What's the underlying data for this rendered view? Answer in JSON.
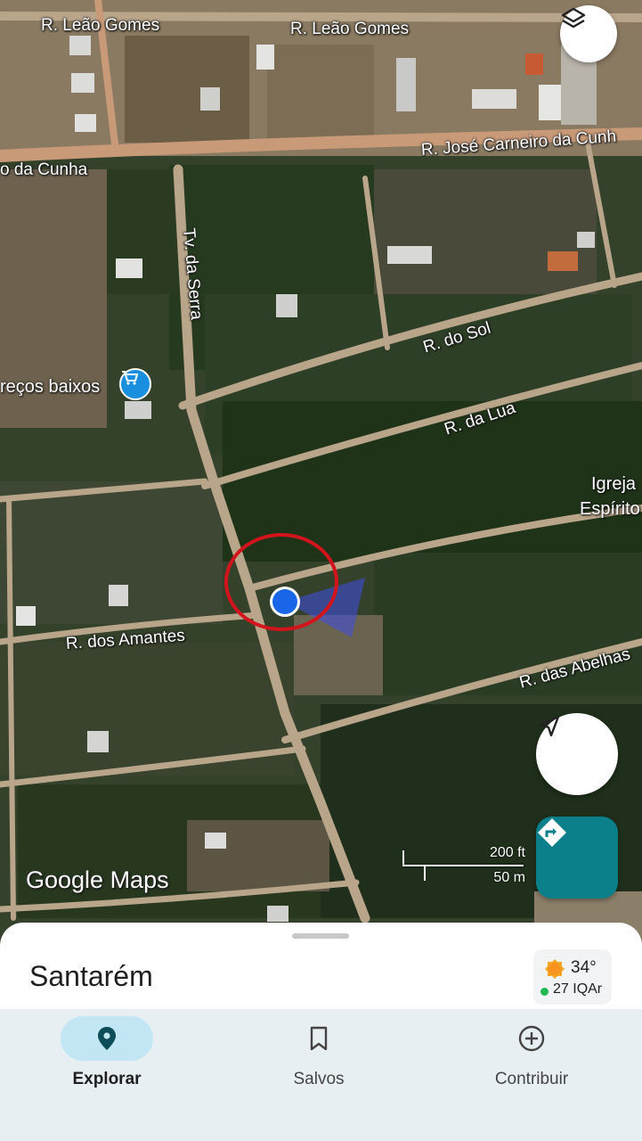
{
  "map": {
    "streets": [
      {
        "name": "R. Leão Gomes"
      },
      {
        "name": "R. Leão Gomes"
      },
      {
        "name": "R. José Carneiro da Cunh"
      },
      {
        "name": "o da Cunha"
      },
      {
        "name": "Tv. da Serra"
      },
      {
        "name": "R. do Sol"
      },
      {
        "name": "R. da Lua"
      },
      {
        "name": "R. dos Amantes"
      },
      {
        "name": "R. das Abelhas"
      }
    ],
    "pois": [
      {
        "name": "reços baixos",
        "icon": "shopping-cart-icon"
      },
      {
        "name": "Igreja",
        "icon": ""
      },
      {
        "name": "Espírito",
        "icon": ""
      }
    ],
    "attribution": "Google Maps",
    "scale": {
      "imperial": "200 ft",
      "metric": "50 m"
    },
    "accent": "#0b7f8a",
    "marker_color": "#1a66e8",
    "highlight_color": "#d4141c"
  },
  "buttons": {
    "layers_icon": "layers-icon",
    "location_icon": "navigation-arrow-icon",
    "directions_icon": "directions-icon"
  },
  "sheet": {
    "place": "Santarém",
    "weather": {
      "temperature": "34°",
      "air_quality": "27 IQAr",
      "icon": "sun-icon"
    }
  },
  "nav": {
    "items": [
      {
        "label": "Explorar",
        "icon": "explore-pin-icon",
        "active": true
      },
      {
        "label": "Salvos",
        "icon": "bookmark-icon",
        "active": false
      },
      {
        "label": "Contribuir",
        "icon": "add-circle-icon",
        "active": false
      }
    ]
  }
}
